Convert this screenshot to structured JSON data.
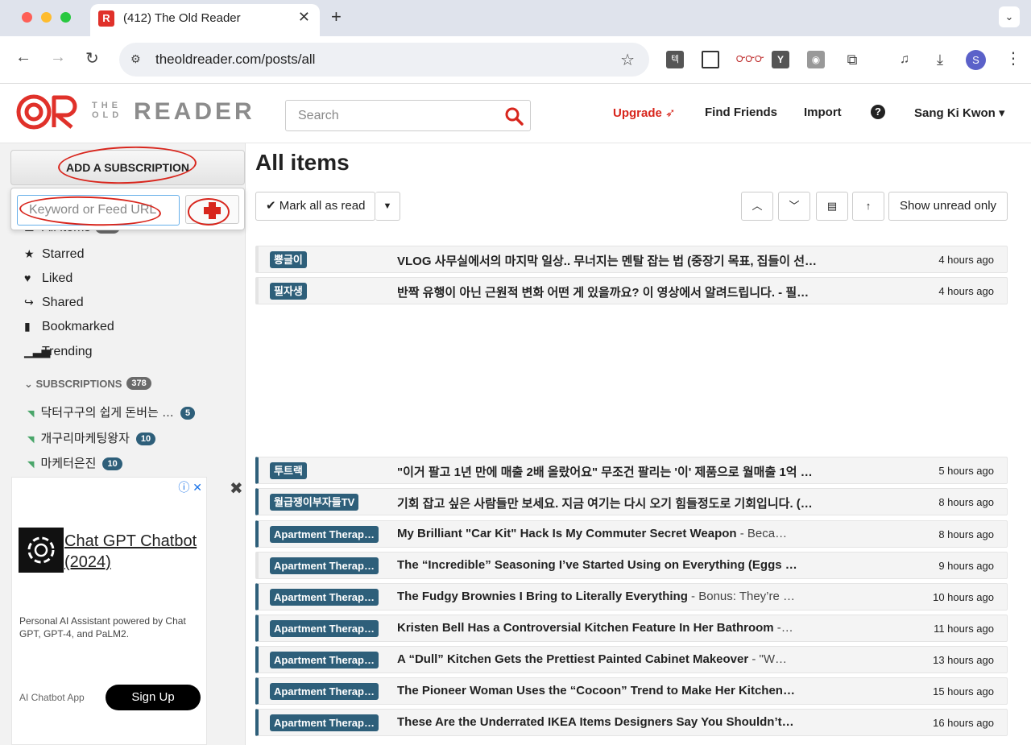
{
  "browser": {
    "tab_title": "(412) The Old Reader",
    "tab_favicon": "R",
    "url": "theoldreader.com/posts/all",
    "profile_initial": "S",
    "ext_1_label": "텍",
    "ext_3_label": "ᏅᏅᏅ",
    "ext_4_label": "Y"
  },
  "header": {
    "logo_the": "THE",
    "logo_old": "OLD",
    "logo_reader": "READER",
    "search_placeholder": "Search",
    "upgrade": "Upgrade",
    "find_friends": "Find Friends",
    "import": "Import",
    "help": "?",
    "user": "Sang Ki Kwon ▾",
    "brand_color": "#e0312a"
  },
  "sidebar": {
    "add_subscription": "ADD A SUBSCRIPTION",
    "sub_placeholder": "Keyword or Feed URL",
    "nav": [
      {
        "label": "All items",
        "count": "412",
        "icon": "list-icon"
      },
      {
        "label": "Starred",
        "icon": "star-icon"
      },
      {
        "label": "Liked",
        "icon": "heart-icon"
      },
      {
        "label": "Shared",
        "icon": "share-icon"
      },
      {
        "label": "Bookmarked",
        "icon": "bookmark-icon"
      },
      {
        "label": "Trending",
        "icon": "trending-icon"
      }
    ],
    "subscriptions_label": "SUBSCRIPTIONS",
    "subscriptions_count": "378",
    "feeds": [
      {
        "name": "닥터구구의 쉽게 돈버는 …",
        "count": "5"
      },
      {
        "name": "개구리마케팅왕자",
        "count": "10"
      },
      {
        "name": "마케터은진",
        "count": "10"
      }
    ]
  },
  "ad": {
    "title": "Chat GPT Chatbot (2024)",
    "description": "Personal AI Assistant powered by Chat GPT, GPT-4, and PaLM2.",
    "app_label": "AI Chatbot App",
    "cta": "Sign Up"
  },
  "main": {
    "title": "All items",
    "mark_all": "Mark all as read",
    "show_unread": "Show unread only",
    "items": [
      {
        "feed": "뿅글이",
        "title": "VLOG 사무실에서의 마지막 일상.. 무너지는 멘탈 잡는 법 (중장기 목표, 집들이 선…",
        "snippet": "",
        "time": "4 hours ago"
      },
      {
        "feed": "필자생",
        "title": "반짝 유행이 아닌 근원적 변화 어떤 게 있을까요? 이 영상에서 알려드립니다. - 필…",
        "snippet": "",
        "time": "4 hours ago"
      },
      {
        "feed": "투트랙",
        "title": "\"이거 팔고 1년 만에 매출 2배 올랐어요\" 무조건 팔리는 '이' 제품으로 월매출 1억 …",
        "snippet": "",
        "time": "5 hours ago"
      },
      {
        "feed": "월급쟁이부자들TV",
        "title": "기회 잡고 싶은 사람들만 보세요. 지금 여기는 다시 오기 힘들정도로 기회입니다. (…",
        "snippet": "",
        "time": "8 hours ago"
      },
      {
        "feed": "Apartment Therap…",
        "title": "My Brilliant \"Car Kit\" Hack Is My Commuter Secret Weapon",
        "snippet": " - Beca…",
        "time": "8 hours ago"
      },
      {
        "feed": "Apartment Therap…",
        "title": "The “Incredible” Seasoning I’ve Started Using on Everything (Eggs …",
        "snippet": "",
        "time": "9 hours ago"
      },
      {
        "feed": "Apartment Therap…",
        "title": "The Fudgy Brownies I Bring to Literally Everything",
        "snippet": " - Bonus: They’re …",
        "time": "10 hours ago"
      },
      {
        "feed": "Apartment Therap…",
        "title": "Kristen Bell Has a Controversial Kitchen Feature In Her Bathroom",
        "snippet": " -…",
        "time": "11 hours ago"
      },
      {
        "feed": "Apartment Therap…",
        "title": "A “Dull” Kitchen Gets the Prettiest Painted Cabinet Makeover",
        "snippet": " - \"W…",
        "time": "13 hours ago"
      },
      {
        "feed": "Apartment Therap…",
        "title": "The Pioneer Woman Uses the “Cocoon” Trend to Make Her Kitchen…",
        "snippet": "",
        "time": "15 hours ago"
      },
      {
        "feed": "Apartment Therap…",
        "title": "These Are the Underrated IKEA Items Designers Say You Shouldn’t…",
        "snippet": "",
        "time": "16 hours ago"
      }
    ]
  }
}
